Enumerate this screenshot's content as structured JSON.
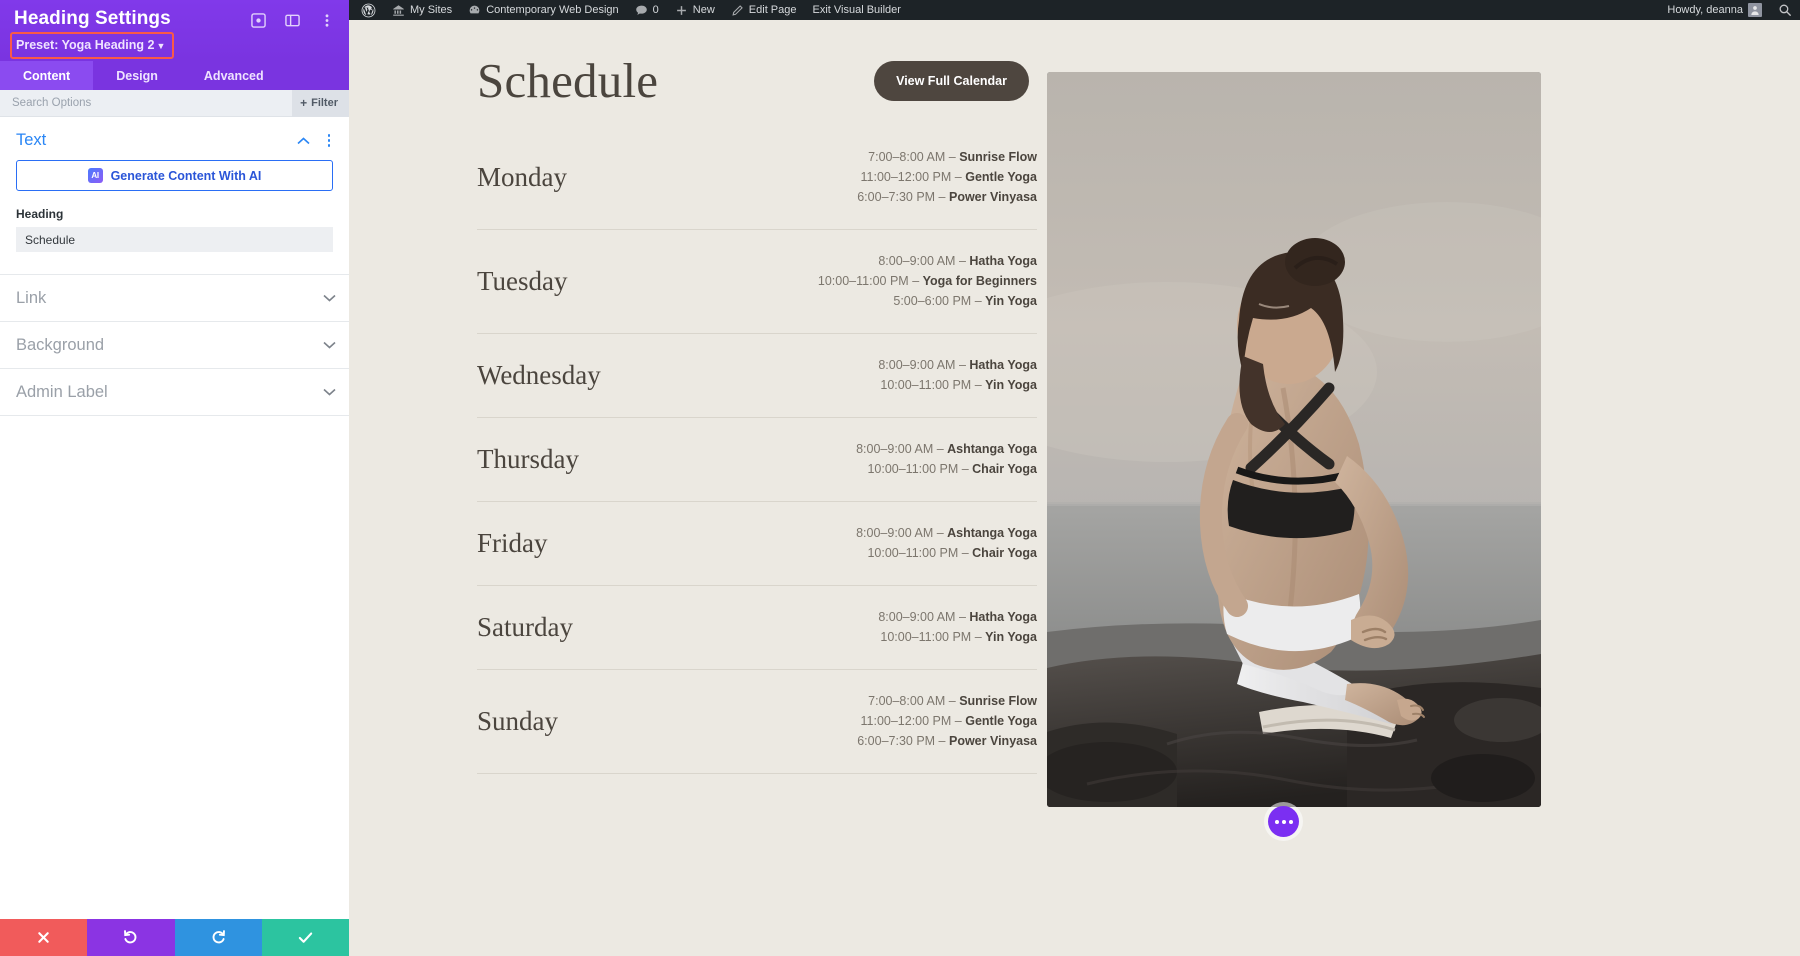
{
  "settings_panel": {
    "title": "Heading Settings",
    "preset_label": "Preset: Yoga Heading 2",
    "header_icons": [
      "target-icon",
      "layout-icon",
      "kebab-menu-icon"
    ],
    "tabs": [
      {
        "label": "Content",
        "active": true
      },
      {
        "label": "Design",
        "active": false
      },
      {
        "label": "Advanced",
        "active": false
      }
    ],
    "search": {
      "placeholder": "Search Options",
      "value": ""
    },
    "filter_label": "Filter",
    "text_section": {
      "title": "Text",
      "ai_button_label": "Generate Content With AI",
      "ai_badge_text": "AI",
      "heading_label": "Heading",
      "heading_value": "Schedule"
    },
    "collapsed_sections": [
      {
        "title": "Link"
      },
      {
        "title": "Background"
      },
      {
        "title": "Admin Label"
      }
    ],
    "footer_buttons": [
      {
        "name": "discard-changes-button",
        "icon": "close-icon",
        "color": "#f15b5b"
      },
      {
        "name": "undo-button",
        "icon": "undo-icon",
        "color": "#8b34e3"
      },
      {
        "name": "redo-button",
        "icon": "redo-icon",
        "color": "#2f93e0"
      },
      {
        "name": "save-changes-button",
        "icon": "check-icon",
        "color": "#2cc4a0"
      }
    ]
  },
  "admin_bar": {
    "wp_logo": "wordpress-logo-icon",
    "items": [
      {
        "label": "My Sites",
        "icon": "sites-icon"
      },
      {
        "label": "Contemporary Web Design",
        "icon": "dashboard-icon"
      },
      {
        "label": "0",
        "icon": "comment-icon"
      },
      {
        "label": "New",
        "icon": "plus-icon"
      },
      {
        "label": "Edit Page",
        "icon": "pencil-icon"
      },
      {
        "label": "Exit Visual Builder",
        "icon": ""
      }
    ],
    "greeting": "Howdy, deanna",
    "search_icon": "search-icon"
  },
  "page": {
    "title": "Schedule",
    "calendar_button": "View Full Calendar",
    "days": [
      {
        "name": "Monday",
        "classes": [
          {
            "time": "7:00–8:00 AM",
            "name": "Sunrise Flow"
          },
          {
            "time": "11:00–12:00 PM",
            "name": "Gentle Yoga"
          },
          {
            "time": "6:00–7:30 PM",
            "name": "Power Vinyasa"
          }
        ]
      },
      {
        "name": "Tuesday",
        "classes": [
          {
            "time": "8:00–9:00 AM",
            "name": "Hatha Yoga"
          },
          {
            "time": "10:00–11:00 PM",
            "name": "Yoga for Beginners"
          },
          {
            "time": "5:00–6:00 PM",
            "name": "Yin Yoga"
          }
        ]
      },
      {
        "name": "Wednesday",
        "classes": [
          {
            "time": "8:00–9:00 AM",
            "name": "Hatha Yoga"
          },
          {
            "time": "10:00–11:00 PM",
            "name": "Yin Yoga"
          }
        ]
      },
      {
        "name": "Thursday",
        "classes": [
          {
            "time": "8:00–9:00 AM",
            "name": "Ashtanga Yoga"
          },
          {
            "time": "10:00–11:00 PM",
            "name": "Chair Yoga"
          }
        ]
      },
      {
        "name": "Friday",
        "classes": [
          {
            "time": "8:00–9:00 AM",
            "name": "Ashtanga Yoga"
          },
          {
            "time": "10:00–11:00 PM",
            "name": "Chair Yoga"
          }
        ]
      },
      {
        "name": "Saturday",
        "classes": [
          {
            "time": "8:00–9:00 AM",
            "name": "Hatha Yoga"
          },
          {
            "time": "10:00–11:00 PM",
            "name": "Yin Yoga"
          }
        ]
      },
      {
        "name": "Sunday",
        "classes": [
          {
            "time": "7:00–8:00 AM",
            "name": "Sunrise Flow"
          },
          {
            "time": "11:00–12:00 PM",
            "name": "Gentle Yoga"
          },
          {
            "time": "6:00–7:30 PM",
            "name": "Power Vinyasa"
          }
        ]
      }
    ],
    "photo_alt": "woman-seated-yoga-pose-on-rock-by-sea",
    "fab_icon": "ellipsis-icon"
  },
  "colors": {
    "panel_purple": "#7a34e0",
    "accent_blue": "#2a86f5",
    "highlight_red": "#fa5a47",
    "canvas_bg": "#ece9e2",
    "text_dark": "#4b453e"
  }
}
